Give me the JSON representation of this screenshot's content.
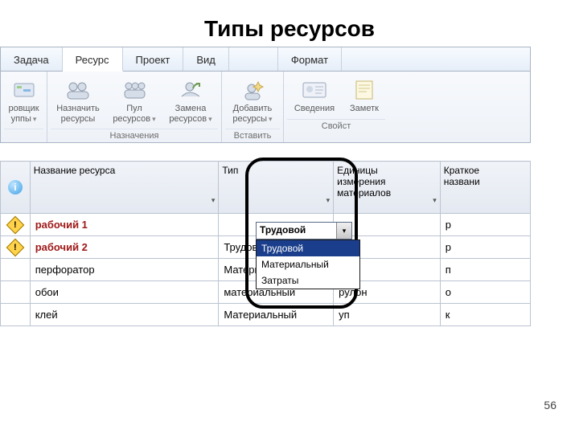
{
  "title": "Типы ресурсов",
  "page_number": "56",
  "ribbon": {
    "tabs": {
      "task": "Задача",
      "resource": "Ресурс",
      "project": "Проект",
      "view": "Вид",
      "format": "Формат"
    },
    "groups": {
      "planner": {
        "label": "ровщик\nуппы"
      },
      "assign": {
        "label": "Назначить\nресурсы"
      },
      "pool": {
        "label": "Пул\nресурсов"
      },
      "replace": {
        "label": "Замена\nресурсов"
      },
      "add": {
        "label": "Добавить\nресурсы"
      },
      "info": {
        "label": "Сведения"
      },
      "notes": {
        "label": "Заметк"
      },
      "group_assignments": "Назначения",
      "group_insert": "Вставить",
      "group_props": "Свойст"
    }
  },
  "sheet": {
    "headers": {
      "name": "Название ресурса",
      "type": "Тип",
      "units": "Единицы\nизмерения\nматериалов",
      "short": "Краткое\nназвани"
    },
    "rows": [
      {
        "name": "рабочий 1",
        "type": "Трудовой",
        "unit": "",
        "short": "р",
        "ind": true,
        "red": true,
        "type_editor": true
      },
      {
        "name": "рабочий 2",
        "type": "Трудовой",
        "unit": "",
        "short": "р",
        "ind": true,
        "red": true
      },
      {
        "name": "перфоратор",
        "type": "Материальный",
        "unit": "",
        "short": "п"
      },
      {
        "name": "обои",
        "type": "материальный",
        "unit": "рулон",
        "short": "о"
      },
      {
        "name": "клей",
        "type": "Материальный",
        "unit": "уп",
        "short": "к"
      }
    ]
  },
  "dropdown": {
    "value": "Трудовой",
    "options": [
      "Трудовой",
      "Материальный",
      "Затраты"
    ],
    "selected_index": 0
  }
}
